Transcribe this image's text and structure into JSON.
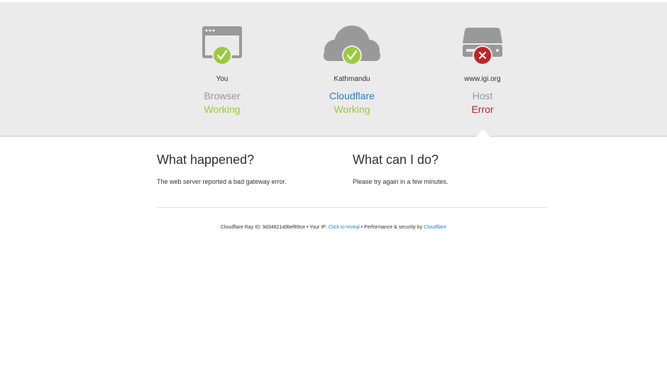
{
  "nodes": [
    {
      "location": "You",
      "kind": "Browser",
      "status": "Working",
      "status_type": "ok",
      "icon": "browser-icon",
      "badge": "check-icon"
    },
    {
      "location": "Kathmandu",
      "kind": "Cloudflare",
      "status": "Working",
      "status_type": "ok",
      "icon": "cloud-icon",
      "badge": "check-icon"
    },
    {
      "location": "www.igi.org",
      "kind": "Host",
      "status": "Error",
      "status_type": "error",
      "icon": "server-icon",
      "badge": "error-x-icon"
    }
  ],
  "what_happened": {
    "title": "What happened?",
    "body": "The web server reported a bad gateway error."
  },
  "what_can_i_do": {
    "title": "What can I do?",
    "body": "Please try again in a few minutes."
  },
  "footer": {
    "ray_label": "Cloudflare Ray ID:",
    "ray_id": "9d34821a9bef89ce",
    "sep1": "•",
    "ip_label": "Your IP:",
    "ip_link": "Click to reveal",
    "sep2": "•",
    "perf_label": "Performance & security by",
    "perf_link": "Cloudflare"
  },
  "colors": {
    "ok": "#9bca3e",
    "error": "#bd2426",
    "link": "#2f7bbf",
    "icon_gray": "#999999",
    "band": "#ebebeb"
  }
}
